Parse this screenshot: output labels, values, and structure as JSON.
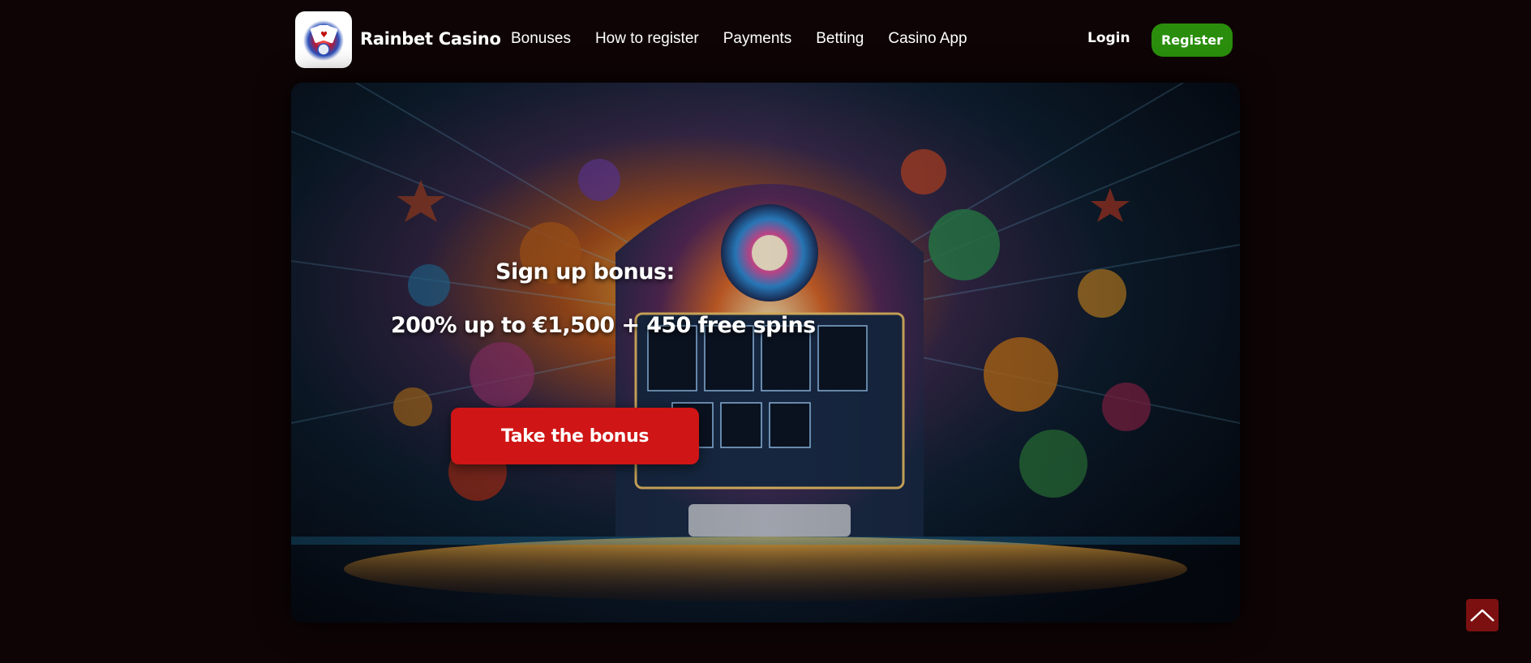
{
  "header": {
    "brand": "Rainbet Casino",
    "logo_icon": "playing-cards-logo-icon",
    "nav": [
      {
        "label": "Bonuses"
      },
      {
        "label": "How to register"
      },
      {
        "label": "Payments"
      },
      {
        "label": "Betting"
      },
      {
        "label": "Casino App"
      }
    ],
    "login_label": "Login",
    "register_label": "Register"
  },
  "hero": {
    "background": "casino-slot-machine-illustration",
    "title": "Sign up bonus:",
    "offer": "200% up to €1,500 + 450 free spins",
    "cta_label": "Take the bonus"
  },
  "scroll_top": {
    "icon": "chevron-up-icon"
  },
  "colors": {
    "page_bg": "#0e0405",
    "register_bg": "#2a8e0c",
    "cta_bg": "#cf1515",
    "scroll_top_bg": "#7c1010"
  }
}
